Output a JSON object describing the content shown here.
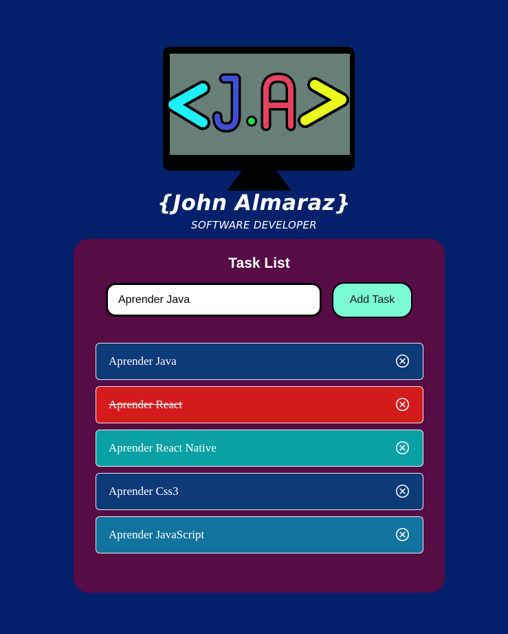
{
  "logo": {
    "monogram": "<J.A>",
    "name": "{John Almaraz}",
    "subtitle": "SOFTWARE DEVELOPER"
  },
  "panel": {
    "title": "Task List",
    "input": {
      "value": "Aprender Java",
      "placeholder": ""
    },
    "add_button_label": "Add Task"
  },
  "tasks": [
    {
      "text": "Aprender Java",
      "completed": false,
      "color": "#0d3a78"
    },
    {
      "text": "Aprender React",
      "completed": true,
      "color": "#d31b1c"
    },
    {
      "text": "Aprender React Native",
      "completed": false,
      "color": "#0aa1a6"
    },
    {
      "text": "Aprender Css3",
      "completed": false,
      "color": "#0d3a78"
    },
    {
      "text": "Aprender JavaScript",
      "completed": false,
      "color": "#12739e"
    }
  ],
  "colors": {
    "page_background": "#03216a",
    "panel_background": "#560c45",
    "add_button": "#7dfad6",
    "monitor_screen": "#677f78",
    "bracket_left": "#1ef0fa",
    "letter_j": "#3d4fd3",
    "dot": "#22e14a",
    "letter_a": "#e4425f",
    "bracket_right": "#e9fa1d"
  }
}
